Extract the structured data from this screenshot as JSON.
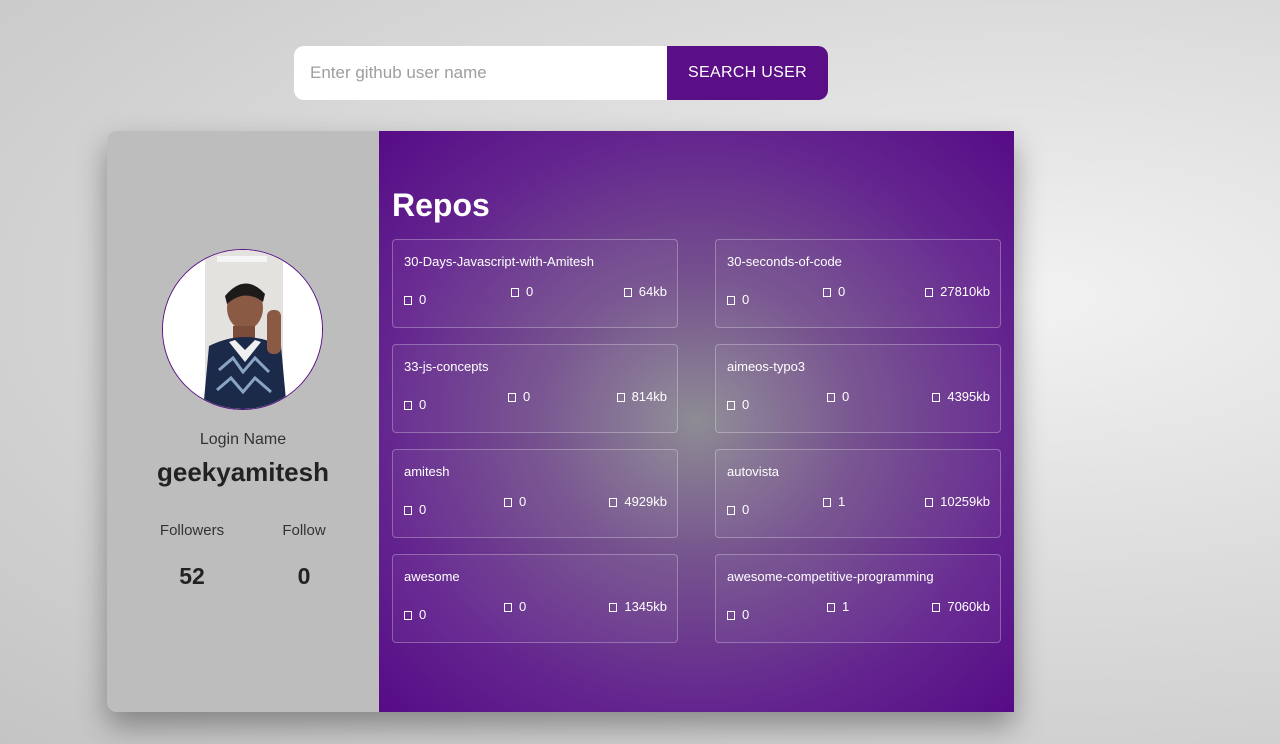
{
  "search": {
    "placeholder": "Enter github user name",
    "button_label": "SEARCH USER"
  },
  "profile": {
    "login_caption": "Login Name",
    "login_name": "geekyamitesh",
    "followers_label": "Followers",
    "followers_count": "52",
    "following_label": "Follow",
    "following_count": "0"
  },
  "repos": {
    "title": "Repos",
    "items": [
      {
        "name": "30-Days-Javascript-with-Amitesh",
        "stars": "0",
        "forks": "0",
        "size": "64kb"
      },
      {
        "name": "30-seconds-of-code",
        "stars": "0",
        "forks": "0",
        "size": "27810kb"
      },
      {
        "name": "33-js-concepts",
        "stars": "0",
        "forks": "0",
        "size": "814kb"
      },
      {
        "name": "aimeos-typo3",
        "stars": "0",
        "forks": "0",
        "size": "4395kb"
      },
      {
        "name": "amitesh",
        "stars": "0",
        "forks": "0",
        "size": "4929kb"
      },
      {
        "name": "autovista",
        "stars": "0",
        "forks": "1",
        "size": "10259kb"
      },
      {
        "name": "awesome",
        "stars": "0",
        "forks": "0",
        "size": "1345kb"
      },
      {
        "name": "awesome-competitive-programming",
        "stars": "0",
        "forks": "1",
        "size": "7060kb"
      }
    ]
  },
  "colors": {
    "accent": "#5a0f86",
    "profile_bg": "#bdbdbd"
  }
}
